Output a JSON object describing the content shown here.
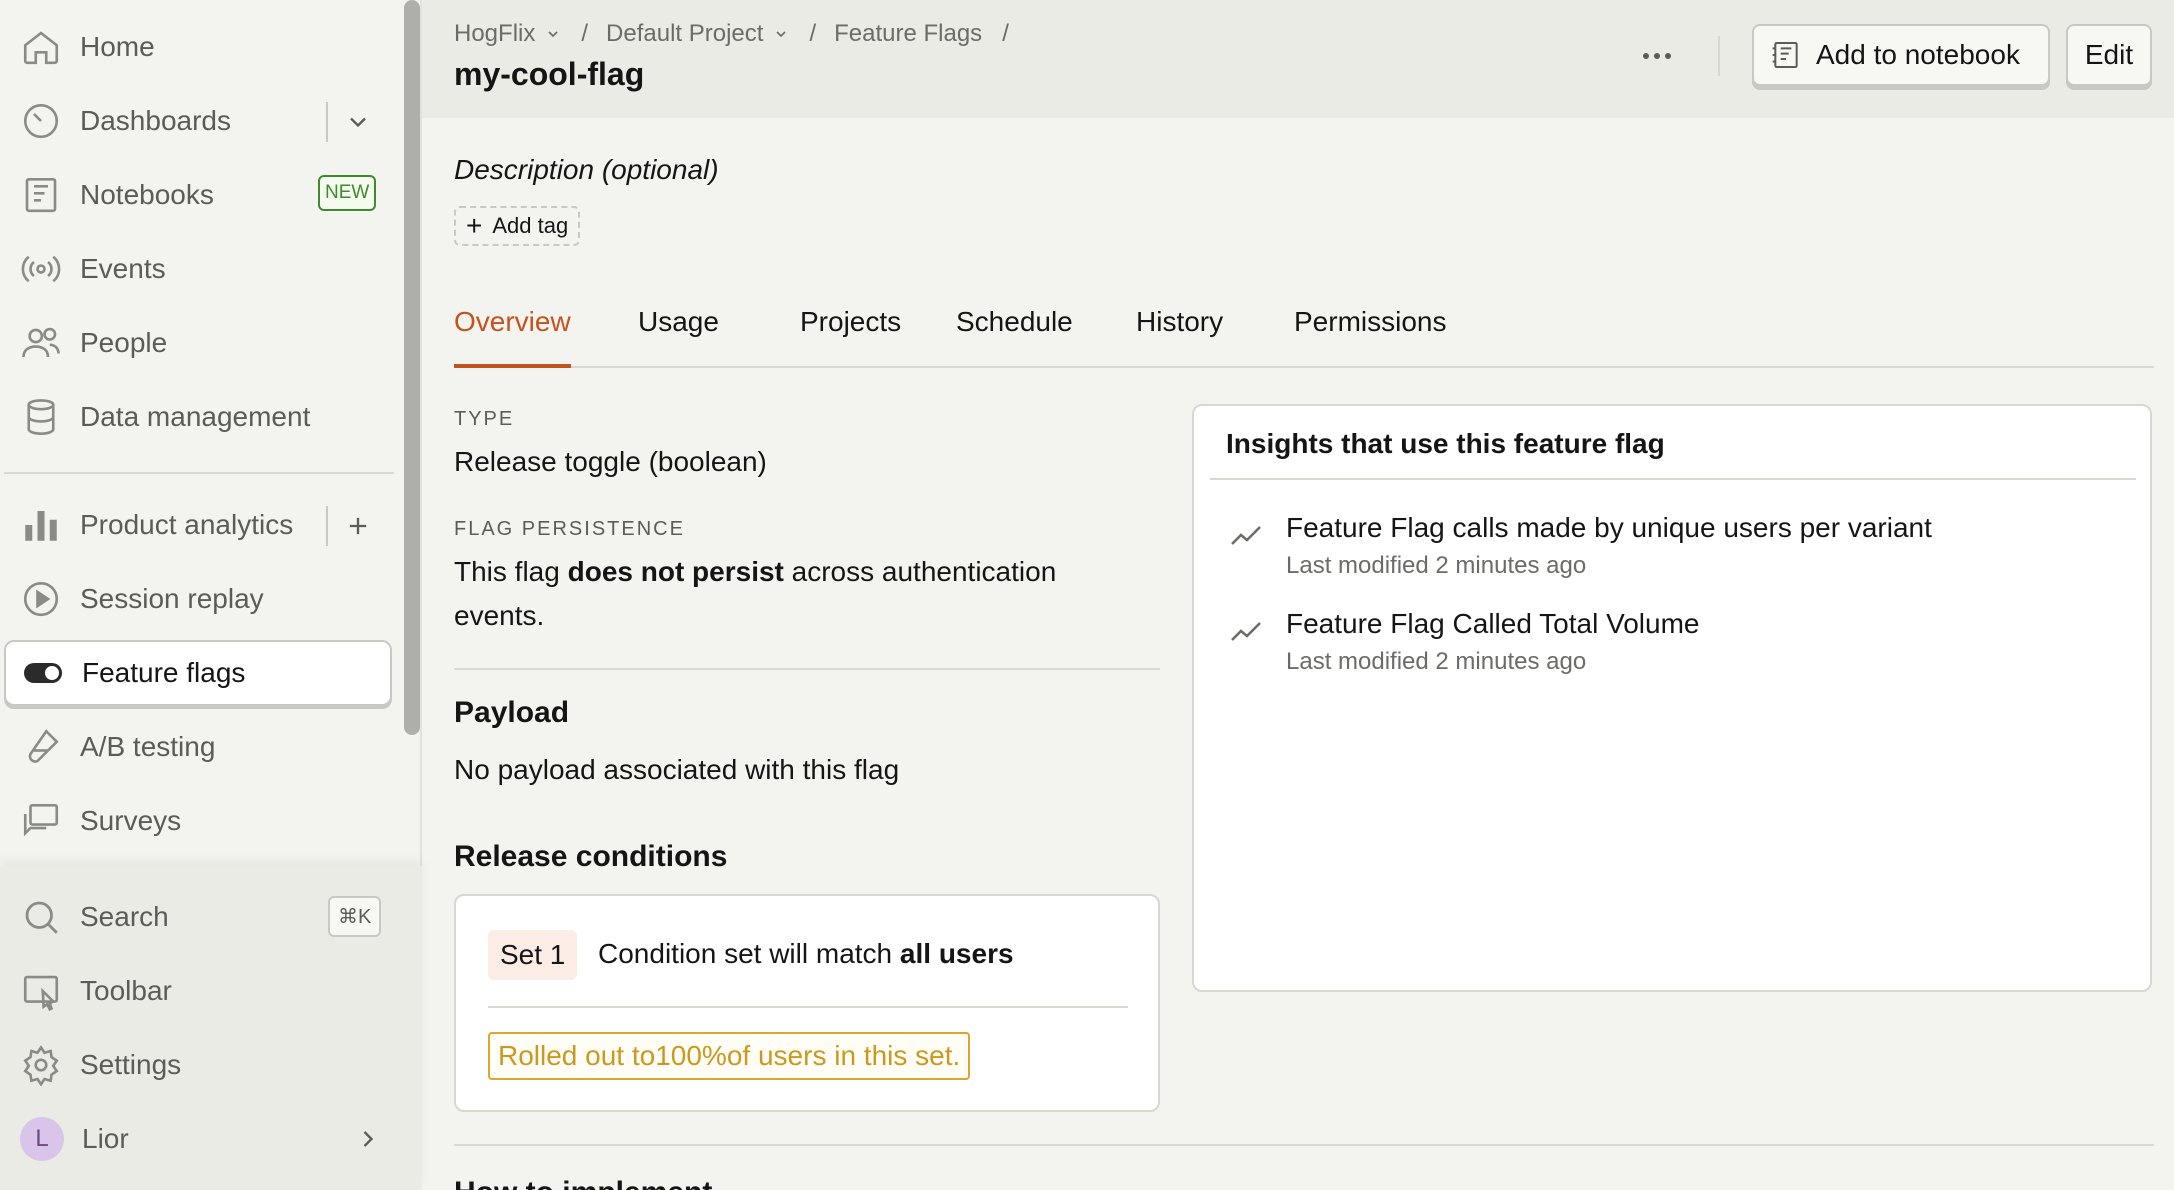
{
  "sidebar": {
    "items": [
      {
        "label": "Home",
        "icon": "home-icon"
      },
      {
        "label": "Dashboards",
        "icon": "dashboard-icon"
      },
      {
        "label": "Notebooks",
        "icon": "notebook-icon",
        "badge": "NEW"
      },
      {
        "label": "Events",
        "icon": "events-icon"
      },
      {
        "label": "People",
        "icon": "people-icon"
      },
      {
        "label": "Data management",
        "icon": "database-icon"
      },
      {
        "label": "Product analytics",
        "icon": "bar-chart-icon"
      },
      {
        "label": "Session replay",
        "icon": "replay-icon"
      },
      {
        "label": "Feature flags",
        "icon": "toggle-icon",
        "active": true
      },
      {
        "label": "A/B testing",
        "icon": "flask-icon"
      },
      {
        "label": "Surveys",
        "icon": "survey-icon"
      }
    ],
    "bottom": {
      "search_label": "Search",
      "search_shortcut": "⌘K",
      "toolbar_label": "Toolbar",
      "settings_label": "Settings",
      "user_name": "Lior",
      "user_initial": "L"
    }
  },
  "header": {
    "breadcrumb": [
      "HogFlix",
      "Default Project",
      "Feature Flags"
    ],
    "title": "my-cool-flag",
    "add_to_notebook": "Add to notebook",
    "edit": "Edit"
  },
  "main": {
    "description_placeholder": "Description (optional)",
    "add_tag": "Add tag",
    "tabs": [
      "Overview",
      "Usage",
      "Projects",
      "Schedule",
      "History",
      "Permissions"
    ],
    "active_tab": "Overview",
    "type_label": "TYPE",
    "type_value": "Release toggle (boolean)",
    "persistence_label": "FLAG PERSISTENCE",
    "persistence_pre": "This flag ",
    "persistence_bold": "does not persist",
    "persistence_post": " across authentication events.",
    "payload_heading": "Payload",
    "payload_text": "No payload associated with this flag",
    "release_heading": "Release conditions",
    "set_label": "Set 1",
    "condition_pre": "Condition set will match ",
    "condition_bold": "all users",
    "rollout_pre": "Rolled out to ",
    "rollout_bold": "100%",
    "rollout_post": " of users in this set.",
    "next_heading": "How to implement"
  },
  "insights": {
    "title": "Insights that use this feature flag",
    "items": [
      {
        "name": "Feature Flag calls made by unique users per variant",
        "meta": "Last modified 2 minutes ago"
      },
      {
        "name": "Feature Flag Called Total Volume",
        "meta": "Last modified 2 minutes ago"
      }
    ]
  },
  "colors": {
    "accent": "#c4541d",
    "rollout": "#d9a72b",
    "new_badge": "#3f8a2f"
  }
}
